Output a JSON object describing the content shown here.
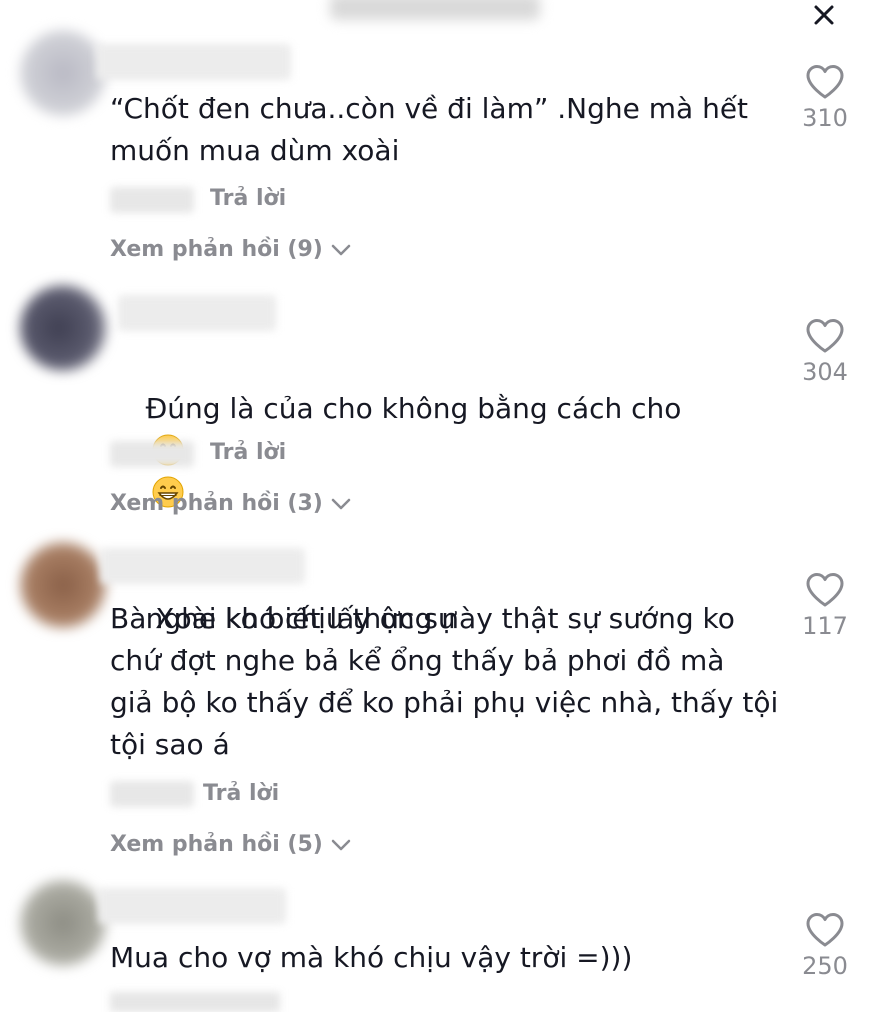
{
  "comments": [
    {
      "text": "“Chốt đen chưa..còn về đi làm” .Nghe mà hết\nmuốn mua dùm xoài",
      "reply_label": "Trả lời",
      "view_replies_label": "Xem phản hồi (9)",
      "likes": "310"
    },
    {
      "text": "Đúng là của cho không bằng cách cho",
      "text_line2": "nghe khó chịu thực sự",
      "emojis": [
        "grinning-face-emoji",
        "grinning-face-emoji"
      ],
      "reply_label": "Trả lời",
      "view_replies_label": "Xem phản hồi (3)",
      "likes": "304"
    },
    {
      "text": "Bà Xoài ko biết lấy ông này thật sự sướng ko\nchứ đợt nghe bả kể ổng thấy bả phơi đồ mà\ngiả bộ ko thấy để ko phải phụ việc nhà, thấy tội\ntội sao á",
      "reply_label": "Trả lời",
      "view_replies_label": "Xem phản hồi (5)",
      "likes": "117"
    },
    {
      "text": "Mua cho vợ mà khó chịu vậy trời =)))",
      "likes": "250"
    }
  ],
  "icons": {
    "close": "close-icon",
    "like": "heart-outline-icon",
    "expand": "chevron-down-icon"
  },
  "colors": {
    "text": "#161823",
    "secondary": "#8a8b91",
    "background": "#ffffff"
  }
}
